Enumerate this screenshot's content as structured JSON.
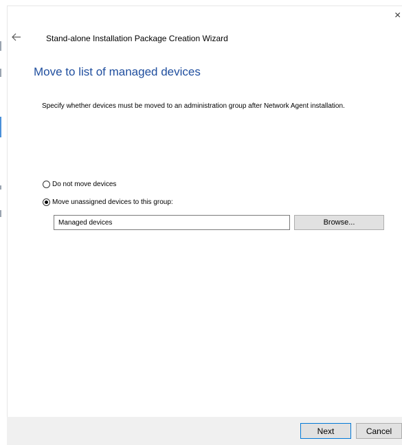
{
  "window": {
    "close_glyph": "×",
    "back_icon": "arrow-left-icon",
    "wizard_title": "Stand-alone Installation Package Creation Wizard"
  },
  "page": {
    "heading": "Move to list of managed devices",
    "description": "Specify whether devices must be moved to an administration group after Network Agent installation."
  },
  "options": {
    "do_not_move_label": "Do not move devices",
    "move_unassigned_label": "Move unassigned devices to this group:",
    "selected": "move_unassigned"
  },
  "group": {
    "value": "Managed devices",
    "browse_label": "Browse..."
  },
  "footer": {
    "next_label": "Next",
    "cancel_label": "Cancel"
  },
  "colors": {
    "heading": "#1f4e9e",
    "footer_bg": "#f0f0f0",
    "default_button_border": "#0078d7"
  }
}
